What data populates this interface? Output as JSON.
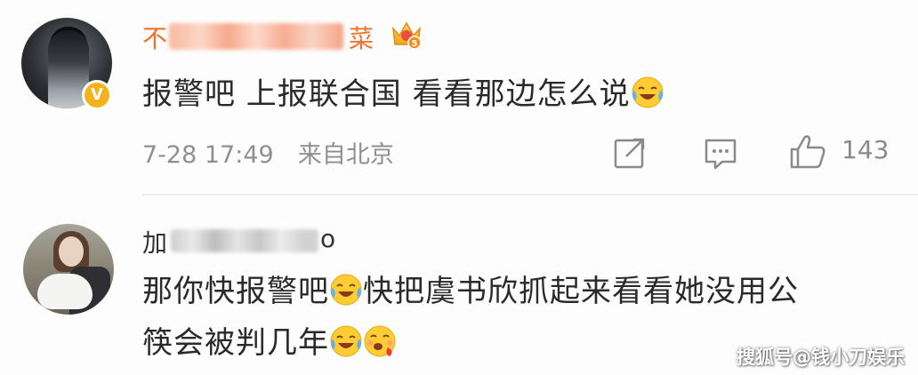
{
  "comments": [
    {
      "username_start": "不",
      "username_end": "菜",
      "badge": "crown-icon",
      "verified": "V",
      "text": "报警吧 上报联合国 看看那边怎么说",
      "text_emoji": "laugh-cry-emoji",
      "time": "7-28 17:49",
      "source": "来自北京",
      "like_count": "143"
    },
    {
      "username_start": "加",
      "username_end": "o",
      "text_line1": "那你快报警吧",
      "text_line1_after": "快把虞书欣抓起来看看她没用公",
      "text_line2": "筷会被判几年",
      "emojis": [
        "laugh-cry-emoji",
        "drooling-emoji"
      ]
    }
  ],
  "actions": {
    "share_icon": "share-icon",
    "reply_icon": "comment-icon",
    "like_icon": "thumbs-up-icon"
  },
  "watermark": "搜狐号@钱小刀娱乐",
  "colors": {
    "username_vip": "#f1712a",
    "meta_gray": "#8f8f8f",
    "verified_gold": "#f6b21c"
  }
}
